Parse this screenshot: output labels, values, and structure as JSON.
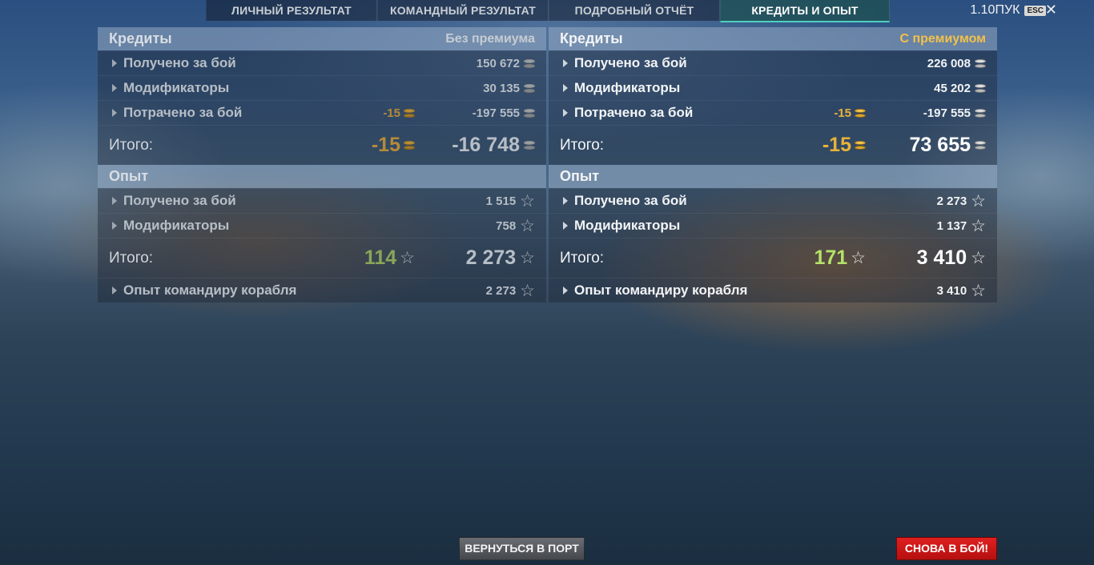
{
  "tabs": [
    {
      "label": "ЛИЧНЫЙ РЕЗУЛЬТАТ"
    },
    {
      "label": "КОМАНДНЫЙ РЕЗУЛЬТАТ"
    },
    {
      "label": "ПОДРОБНЫЙ ОТЧЁТ"
    },
    {
      "label": "КРЕДИТЫ И ОПЫТ"
    }
  ],
  "active_tab": "КРЕДИТЫ И ОПЫТ",
  "version": "1.10ПУК",
  "esc_label": "ESC",
  "close_glyph": "✕",
  "colors": {
    "premium_gold": "#f2c14a",
    "xp_green": "#b6e36a",
    "battle_red": "#d81818"
  },
  "left": {
    "credits_title": "Кредиты",
    "credits_sub": "Без премиума",
    "credits_rows": [
      {
        "label": "Получено за бой",
        "value": "150 672"
      },
      {
        "label": "Модификаторы",
        "value": "30 135"
      },
      {
        "label": "Потрачено за бой",
        "prem": "-15",
        "value": "-197 555"
      }
    ],
    "credits_total": {
      "label": "Итого:",
      "prem": "-15",
      "value": "-16 748"
    },
    "xp_title": "Опыт",
    "xp_rows": [
      {
        "label": "Получено за бой",
        "value": "1 515"
      },
      {
        "label": "Модификаторы",
        "value": "758"
      }
    ],
    "xp_total": {
      "label": "Итого:",
      "prem": "114",
      "value": "2 273"
    },
    "commander": {
      "label": "Опыт командиру корабля",
      "value": "2 273"
    }
  },
  "right": {
    "credits_title": "Кредиты",
    "credits_sub": "С премиумом",
    "credits_rows": [
      {
        "label": "Получено за бой",
        "value": "226 008"
      },
      {
        "label": "Модификаторы",
        "value": "45 202"
      },
      {
        "label": "Потрачено за бой",
        "prem": "-15",
        "value": "-197 555"
      }
    ],
    "credits_total": {
      "label": "Итого:",
      "prem": "-15",
      "value": "73 655"
    },
    "xp_title": "Опыт",
    "xp_rows": [
      {
        "label": "Получено за бой",
        "value": "2 273"
      },
      {
        "label": "Модификаторы",
        "value": "1 137"
      }
    ],
    "xp_total": {
      "label": "Итого:",
      "prem": "171",
      "value": "3 410"
    },
    "commander": {
      "label": "Опыт командиру корабля",
      "value": "3 410"
    }
  },
  "buttons": {
    "port": "ВЕРНУТЬСЯ В ПОРТ",
    "battle": "СНОВА В БОЙ!"
  }
}
